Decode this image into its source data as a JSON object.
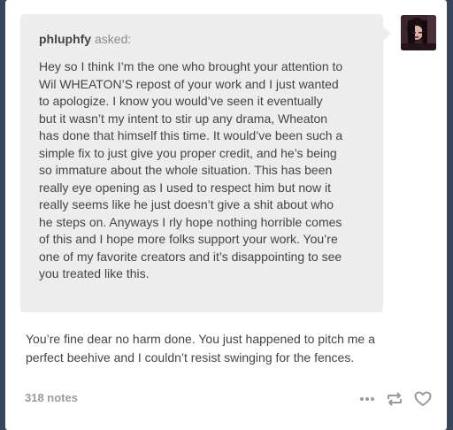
{
  "ask": {
    "asker_name": "phluphfy",
    "asked_label": "asked:",
    "question": "Hey so I think I’m the one who brought your attention to\nWil WHEATON’S repost of your work and I just wanted\nto apologize. I know you would’ve seen it eventually\nbut it wasn’t my intent to stir up any drama, Wheaton\nhas done that himself this time. It would’ve been such a\nsimple fix to just give you proper credit, and he’s being\nso immature about the whole situation. This has been\nreally eye opening as I used to respect him but now it\nreally seems like he just doesn’t give a shit about who\nhe steps on. Anyways I rly hope nothing horrible comes\nof this and I hope more folks support your work. You’re\none of my favorite creators and it’s disappointing to see\nyou treated like this."
  },
  "answer": {
    "text": "You’re fine dear no harm done. You just happened to pitch me a\nperfect beehive and I couldn’t resist swinging for the fences."
  },
  "footer": {
    "notes": "318 notes",
    "icons": [
      "more-icon",
      "reblog-icon",
      "like-icon"
    ]
  },
  "colors": {
    "background": "#36465d",
    "card": "#ffffff",
    "bubble": "#ededed",
    "text": "#444444",
    "muted": "#9b9b9b"
  }
}
